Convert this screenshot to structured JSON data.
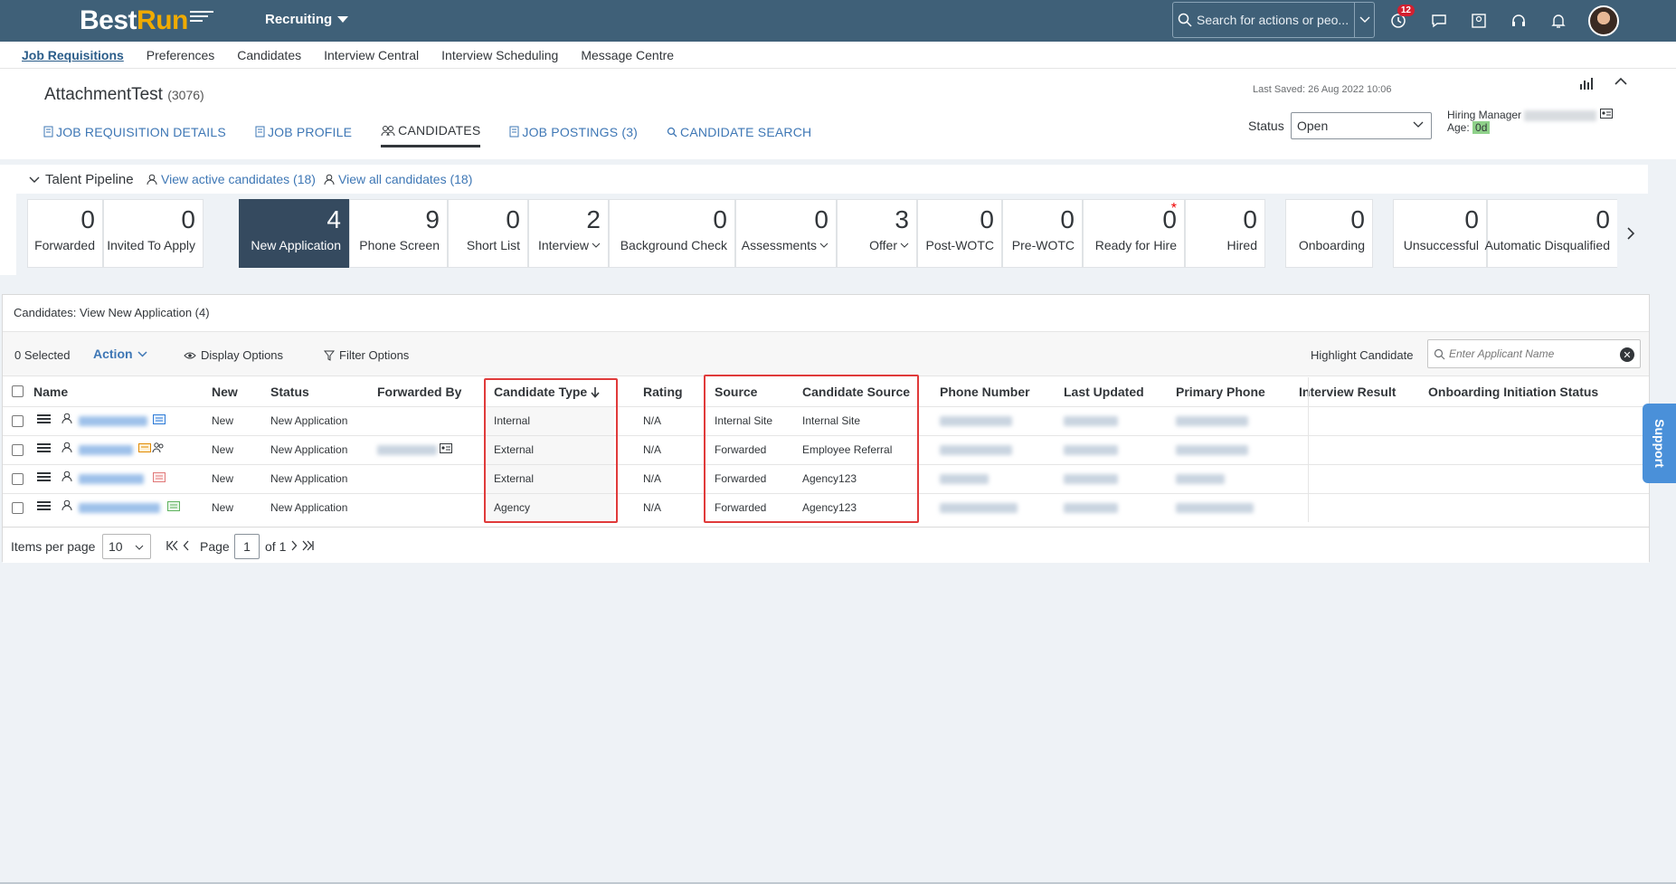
{
  "shell": {
    "logo_best": "Best",
    "logo_run": "Run",
    "module": "Recruiting",
    "search_placeholder": "Search for actions or peo...",
    "notification_count": "12"
  },
  "subnav": [
    "Job Requisitions",
    "Preferences",
    "Candidates",
    "Interview Central",
    "Interview Scheduling",
    "Message Centre"
  ],
  "header": {
    "title": "AttachmentTest",
    "id": "(3076)",
    "last_saved": "Last Saved: 26 Aug 2022 10:06",
    "tabs": [
      "JOB REQUISITION DETAILS",
      "JOB PROFILE",
      "CANDIDATES",
      "JOB POSTINGS (3)",
      "CANDIDATE SEARCH"
    ],
    "status_label": "Status",
    "status_value": "Open",
    "hiring_manager_label": "Hiring Manager",
    "age_label": "Age:",
    "age_value": "0d"
  },
  "pipeline": {
    "title": "Talent Pipeline",
    "view_active": "View active candidates (18)",
    "view_all": "View all candidates (18)",
    "tiles": [
      {
        "count": "0",
        "label": "Forwarded"
      },
      {
        "count": "0",
        "label": "Invited To Apply"
      },
      {
        "count": "4",
        "label": "New Application"
      },
      {
        "count": "9",
        "label": "Phone Screen"
      },
      {
        "count": "0",
        "label": "Short List"
      },
      {
        "count": "2",
        "label": "Interview"
      },
      {
        "count": "0",
        "label": "Background Check"
      },
      {
        "count": "0",
        "label": "Assessments"
      },
      {
        "count": "3",
        "label": "Offer"
      },
      {
        "count": "0",
        "label": "Post-WOTC"
      },
      {
        "count": "0",
        "label": "Pre-WOTC"
      },
      {
        "count": "0",
        "label": "Ready for Hire"
      },
      {
        "count": "0",
        "label": "Hired"
      },
      {
        "count": "0",
        "label": "Onboarding"
      },
      {
        "count": "0",
        "label": "Unsuccessful"
      },
      {
        "count": "0",
        "label": "Automatic Disqualified"
      }
    ]
  },
  "table": {
    "panel_title": "Candidates: View New Application (4)",
    "selected": "0 Selected",
    "action": "Action",
    "display_options": "Display Options",
    "filter_options": "Filter Options",
    "highlight_label": "Highlight Candidate",
    "highlight_placeholder": "Enter Applicant Name",
    "columns": [
      "Name",
      "New",
      "Status",
      "Forwarded By",
      "Candidate Type",
      "Rating",
      "Source",
      "Candidate Source",
      "Phone Number",
      "Last Updated",
      "Primary Phone",
      "Interview Result",
      "Onboarding Initiation Status"
    ],
    "rows": [
      {
        "new": "New",
        "status": "New Application",
        "type": "Internal",
        "rating": "N/A",
        "source": "Internal Site",
        "cand_source": "Internal Site"
      },
      {
        "new": "New",
        "status": "New Application",
        "type": "External",
        "rating": "N/A",
        "source": "Forwarded",
        "cand_source": "Employee Referral"
      },
      {
        "new": "New",
        "status": "New Application",
        "type": "External",
        "rating": "N/A",
        "source": "Forwarded",
        "cand_source": "Agency123"
      },
      {
        "new": "New",
        "status": "New Application",
        "type": "Agency",
        "rating": "N/A",
        "source": "Forwarded",
        "cand_source": "Agency123"
      }
    ]
  },
  "pager": {
    "items_label": "Items per page",
    "items_value": "10",
    "page_label": "Page",
    "page_value": "1",
    "of_label": "of 1"
  },
  "support": "Support"
}
